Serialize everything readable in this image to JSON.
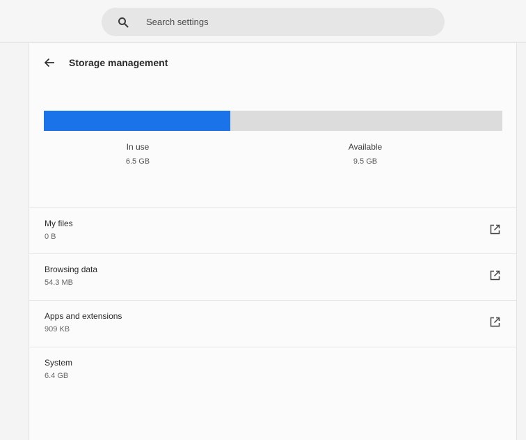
{
  "search": {
    "placeholder": "Search settings"
  },
  "page": {
    "title": "Storage management"
  },
  "usage": {
    "used_fraction": 0.406,
    "in_use_label": "In use",
    "in_use_value": "6.5 GB",
    "available_label": "Available",
    "available_value": "9.5 GB",
    "bar_fill_color": "#1a73e8",
    "bar_track_color": "#dcdcdc"
  },
  "items": [
    {
      "name": "My files",
      "size": "0 B",
      "icon": "open-in-new-icon"
    },
    {
      "name": "Browsing data",
      "size": "54.3 MB",
      "icon": "open-in-new-icon"
    },
    {
      "name": "Apps and extensions",
      "size": "909 KB",
      "icon": "open-in-new-icon"
    },
    {
      "name": "System",
      "size": "6.4 GB",
      "icon": ""
    }
  ]
}
